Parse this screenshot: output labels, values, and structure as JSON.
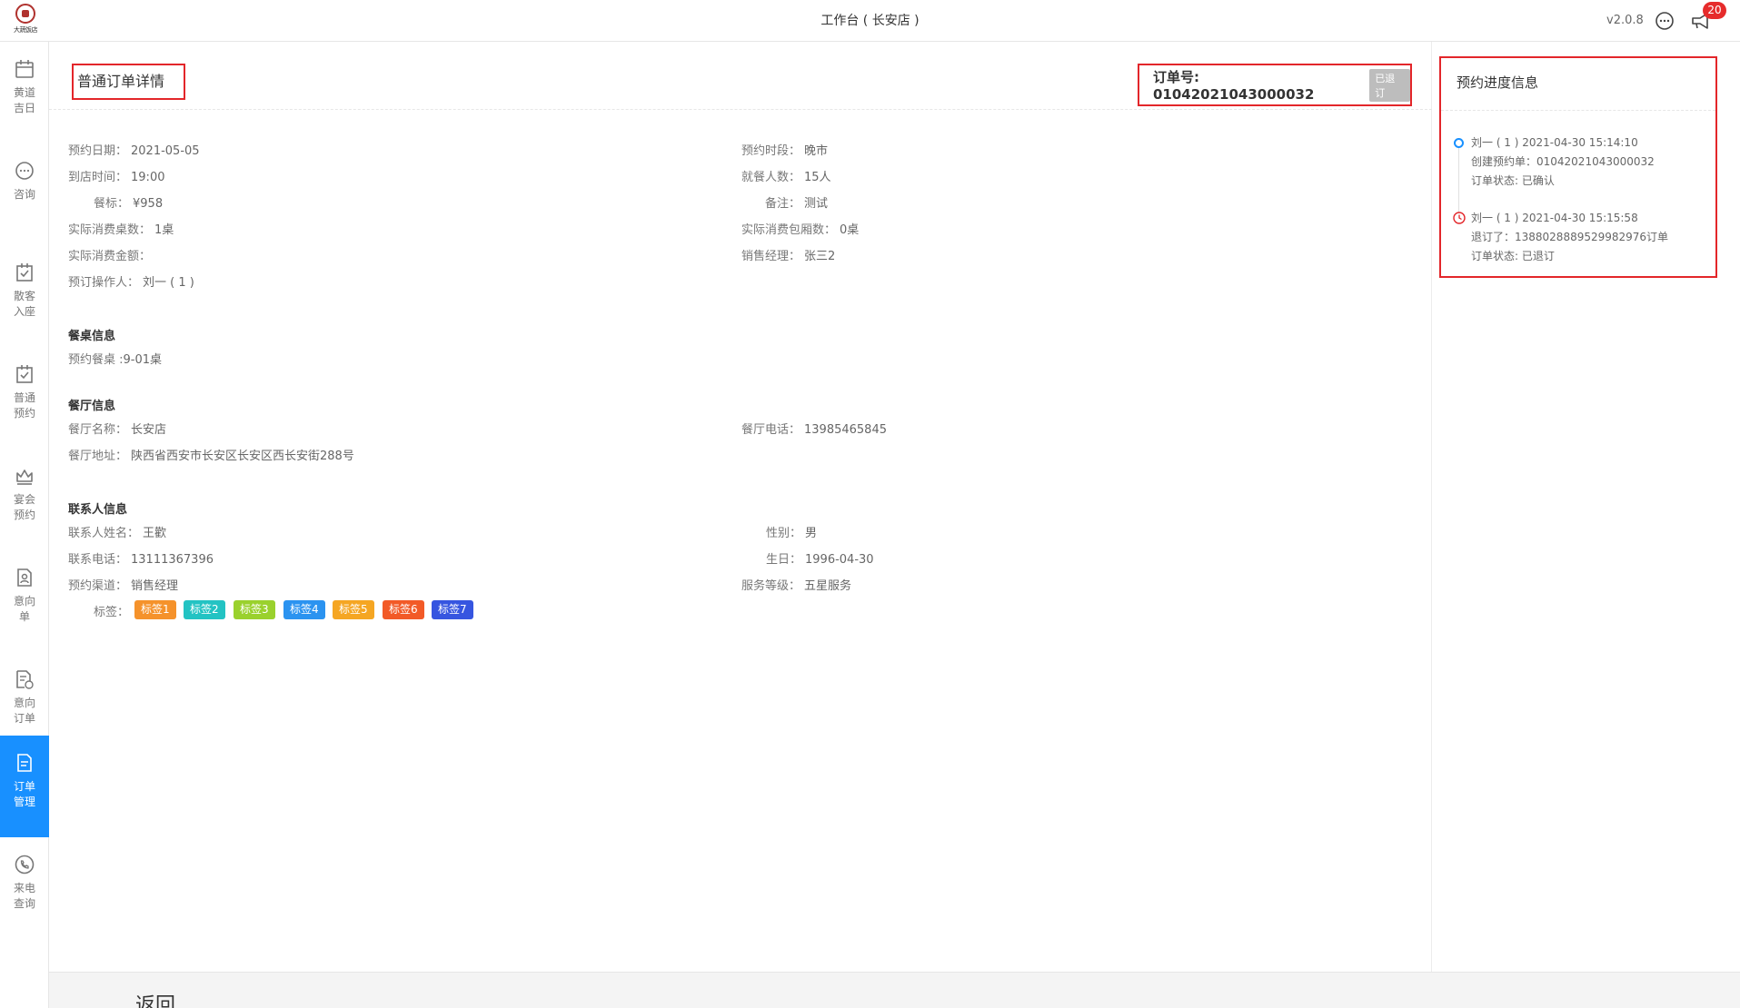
{
  "header": {
    "logo_text": "大蔬饭店",
    "title": "工作台 ( 长安店 )",
    "version": "v2.0.8",
    "notice_count": "20"
  },
  "sidebar": {
    "items": [
      {
        "label": "黄道吉日",
        "icon": "calendar-icon"
      },
      {
        "label": "咨询",
        "icon": "chat-icon"
      },
      {
        "label": "散客入座",
        "icon": "checkin-icon"
      },
      {
        "label": "普通预约",
        "icon": "reservation-icon"
      },
      {
        "label": "宴会预约",
        "icon": "banquet-icon"
      },
      {
        "label": "意向单",
        "icon": "intent-icon"
      },
      {
        "label": "意向订单",
        "icon": "intent-order-icon"
      },
      {
        "label": "订单管理",
        "icon": "order-icon",
        "active": true
      },
      {
        "label": "来电查询",
        "icon": "phone-icon"
      }
    ]
  },
  "detail": {
    "title": "普通订单详情",
    "order_no": "订单号: 01042021043000032",
    "status": "已退订",
    "fields": {
      "date_k": "预约日期：",
      "date_v": "2021-05-05",
      "period_k": "预约时段：",
      "period_v": "晚市",
      "arrive_k": "到店时间：",
      "arrive_v": "19:00",
      "guests_k": "就餐人数：",
      "guests_v": "15人",
      "standard_k": "餐标：",
      "standard_v": "¥958",
      "remark_k": "备注：",
      "remark_v": "测试",
      "tables_k": "实际消费桌数：",
      "tables_v": "1桌",
      "rooms_k": "实际消费包厢数：",
      "rooms_v": "0桌",
      "amount_k": "实际消费金额：",
      "amount_v": "",
      "manager_k": "销售经理：",
      "manager_v": "张三2",
      "operator_k": "预订操作人：",
      "operator_v": "刘一 ( 1 )"
    },
    "table_section": {
      "title": "餐桌信息",
      "reserved_k": "预约餐桌 :",
      "reserved_v": "9-01桌"
    },
    "restaurant_section": {
      "title": "餐厅信息",
      "name_k": "餐厅名称：",
      "name_v": "长安店",
      "phone_k": "餐厅电话：",
      "phone_v": "13985465845",
      "addr_k": "餐厅地址：",
      "addr_v": "陕西省西安市长安区长安区西长安街288号"
    },
    "contact_section": {
      "title": "联系人信息",
      "name_k": "联系人姓名：",
      "name_v": "王歡",
      "gender_k": "性别：",
      "gender_v": "男",
      "phone_k": "联系电话：",
      "phone_v": "13111367396",
      "birthday_k": "生日：",
      "birthday_v": "1996-04-30",
      "channel_k": "预约渠道：",
      "channel_v": "销售经理",
      "level_k": "服务等级：",
      "level_v": "五星服务",
      "tags_k": "标签：",
      "tags": [
        {
          "label": "标签1",
          "color": "#f5922b"
        },
        {
          "label": "标签2",
          "color": "#23c3c3"
        },
        {
          "label": "标签3",
          "color": "#9ad12d"
        },
        {
          "label": "标签4",
          "color": "#2b93f0"
        },
        {
          "label": "标签5",
          "color": "#f5a623"
        },
        {
          "label": "标签6",
          "color": "#f25a27"
        },
        {
          "label": "标签7",
          "color": "#3655e0"
        }
      ]
    }
  },
  "progress": {
    "title": "预约进度信息",
    "events": [
      {
        "line1": "刘一 ( 1 ) 2021-04-30 15:14:10",
        "line2": "创建预约单：01042021043000032",
        "line3": "订单状态: 已确认"
      },
      {
        "line1": "刘一 ( 1 ) 2021-04-30 15:15:58",
        "line2": "退订了：1388028889529982976订单",
        "line3": "订单状态: 已退订"
      }
    ]
  },
  "footer": {
    "back_label": "返回"
  },
  "colors": {
    "accent": "#1890ff",
    "highlight_border": "#e3262a",
    "badge": "#e62b2b"
  }
}
